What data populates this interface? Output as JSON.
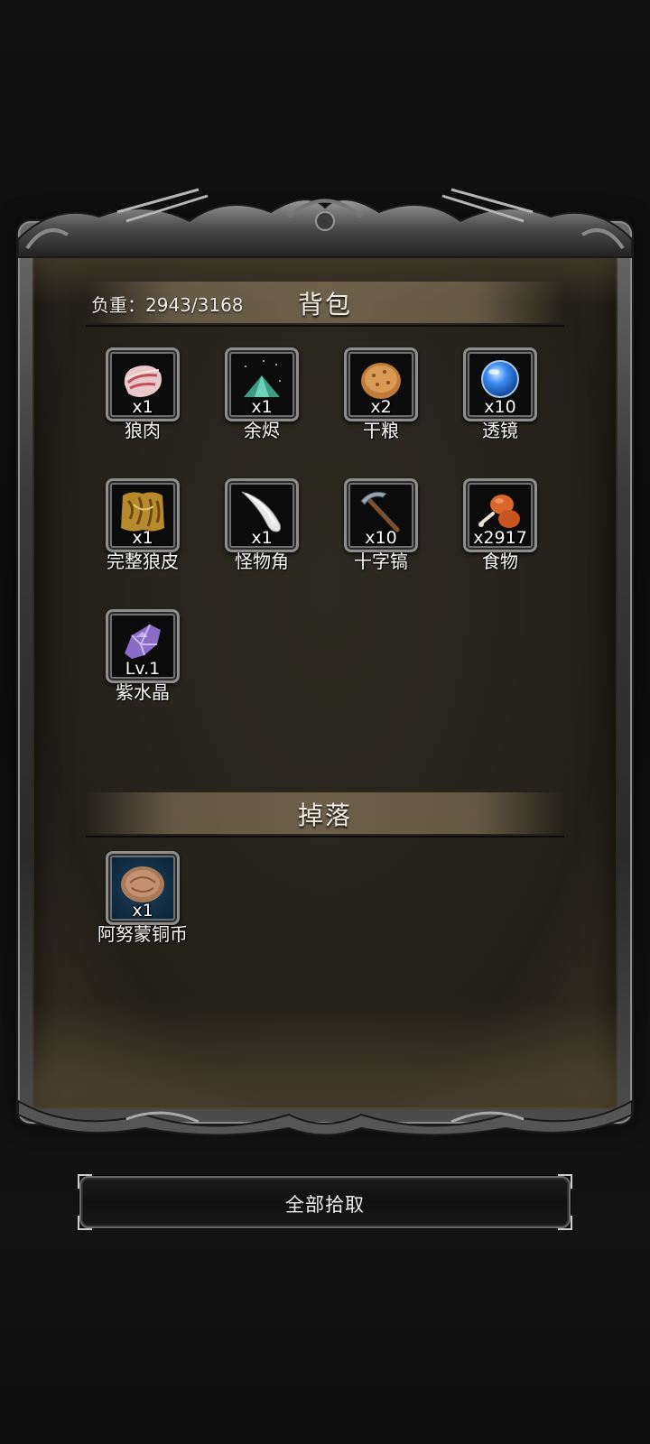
{
  "backpack": {
    "title": "背包",
    "weight_label": "负重：2943/3168",
    "items": [
      {
        "name": "狼肉",
        "count": "x1",
        "icon": "wolf-meat-icon"
      },
      {
        "name": "余烬",
        "count": "x1",
        "icon": "ember-icon"
      },
      {
        "name": "干粮",
        "count": "x2",
        "icon": "dry-ration-icon"
      },
      {
        "name": "透镜",
        "count": "x10",
        "icon": "lens-icon"
      },
      {
        "name": "完整狼皮",
        "count": "x1",
        "icon": "wolf-pelt-icon"
      },
      {
        "name": "怪物角",
        "count": "x1",
        "icon": "monster-horn-icon"
      },
      {
        "name": "十字镐",
        "count": "x10",
        "icon": "pickaxe-icon"
      },
      {
        "name": "食物",
        "count": "x2917",
        "icon": "food-drumstick-icon"
      },
      {
        "name": "紫水晶",
        "count": "Lv.1",
        "icon": "amethyst-icon"
      }
    ]
  },
  "drops": {
    "title": "掉落",
    "items": [
      {
        "name": "阿努蒙铜币",
        "count": "x1",
        "icon": "copper-coin-icon"
      }
    ]
  },
  "actions": {
    "collect_all_label": "全部拾取"
  },
  "colors": {
    "background": "#0d0d0d",
    "panel": "#27241d",
    "frame": "#4a4a4a",
    "text": "#ffffff"
  }
}
